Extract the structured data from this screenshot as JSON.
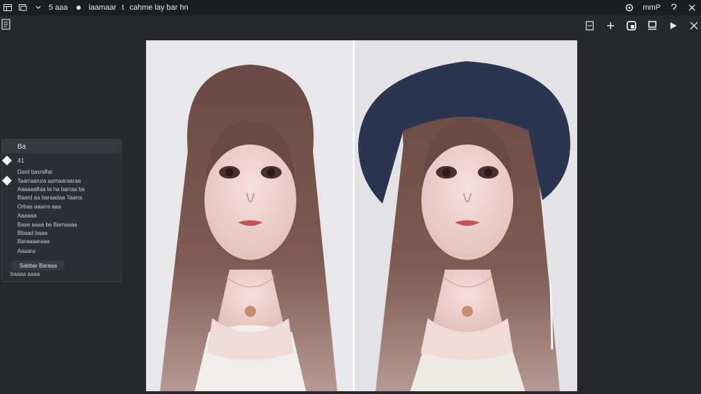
{
  "topbar": {
    "icons": [
      "layout-icon",
      "window-icon",
      "dropdown-caret-icon"
    ],
    "item1": "5 aaa",
    "item2": "laamaar",
    "item3": "t",
    "item4": "cahme lay bar hn",
    "right_item": "mmP"
  },
  "toolbar": {
    "right_icons": [
      "panel-toggle-icon",
      "plus-icon",
      "copy-icon",
      "layers-icon",
      "play-icon",
      "close-icon"
    ]
  },
  "panel": {
    "title": "Ba",
    "field_value": "41",
    "rows": [
      "Dard basraflar",
      "Taarraarura aamaaraaraa",
      "Aaaaaaflaa ta ha barraa ba",
      "Baard aa baraadaa Taarra",
      "Orbas aaarra aaa",
      "Aaaaaa",
      "Base aaaa ba Bamaaaa",
      "Bbaad baaa",
      "Baraaaaraaa",
      "Aaaara"
    ],
    "button_label": "Sabbar Baraaa",
    "sub_label": "baaaa aaaa"
  },
  "canvas": {
    "images": [
      {
        "name": "portrait-without-hat"
      },
      {
        "name": "portrait-with-hat"
      }
    ]
  },
  "colors": {
    "background": "#26292c",
    "topbar": "#1b1d20",
    "panel": "#2b2f33",
    "hat": "#2a3550"
  }
}
